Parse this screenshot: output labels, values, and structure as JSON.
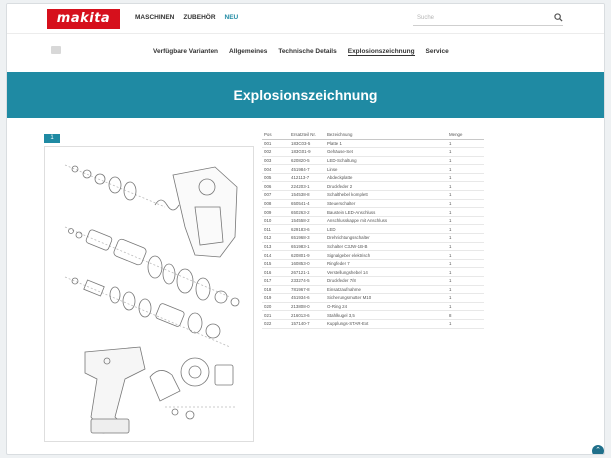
{
  "brand": {
    "logo_text": "makita",
    "color": "#d6101c",
    "accent": "#1f8aa3"
  },
  "nav": {
    "items": [
      {
        "label": "MASCHINEN",
        "active": false
      },
      {
        "label": "ZUBEHÖR",
        "active": false
      },
      {
        "label": "NEU",
        "active": true
      }
    ]
  },
  "search": {
    "placeholder": "Suche",
    "icon": "search-icon"
  },
  "subnav": {
    "items": [
      {
        "label": "Verfügbare Varianten",
        "active": false
      },
      {
        "label": "Allgemeines",
        "active": false
      },
      {
        "label": "Technische Details",
        "active": false
      },
      {
        "label": "Explosionszeichnung",
        "active": true
      },
      {
        "label": "Service",
        "active": false
      }
    ]
  },
  "banner": {
    "title": "Explosionszeichnung"
  },
  "diagram": {
    "page_label": "1"
  },
  "parts_table": {
    "headers": {
      "pos": "Pos",
      "nr": "Ersatzteil Nr.",
      "name": "Bezeichnung",
      "qty": "Menge"
    },
    "rows": [
      {
        "pos": "001",
        "nr": "183C03-5",
        "name": "Platte 1",
        "qty": "1"
      },
      {
        "pos": "002",
        "nr": "183G01-9",
        "name": "Gehäuse-Set",
        "qty": "1"
      },
      {
        "pos": "003",
        "nr": "620820-5",
        "name": "LED-Schaltung",
        "qty": "1"
      },
      {
        "pos": "004",
        "nr": "451984-7",
        "name": "Linse",
        "qty": "1"
      },
      {
        "pos": "005",
        "nr": "412113-7",
        "name": "Abdeckplatte",
        "qty": "1"
      },
      {
        "pos": "006",
        "nr": "224203-1",
        "name": "Druckfeder 2",
        "qty": "1"
      },
      {
        "pos": "007",
        "nr": "154538-8",
        "name": "Schalthebel komplett",
        "qty": "1"
      },
      {
        "pos": "008",
        "nr": "650541-4",
        "name": "Steuerschalter",
        "qty": "1"
      },
      {
        "pos": "009",
        "nr": "650263-2",
        "name": "Baustein LED-Anschluss",
        "qty": "1"
      },
      {
        "pos": "010",
        "nr": "154558-2",
        "name": "Anschlusskappe mit Anschluss",
        "qty": "1"
      },
      {
        "pos": "011",
        "nr": "629183-6",
        "name": "LED",
        "qty": "1"
      },
      {
        "pos": "012",
        "nr": "651968-3",
        "name": "Drehrichtungsschalter",
        "qty": "1"
      },
      {
        "pos": "013",
        "nr": "651983-1",
        "name": "Schalter C3JW-1B-B",
        "qty": "1"
      },
      {
        "pos": "014",
        "nr": "620801-9",
        "name": "Signalgeber elektrisch",
        "qty": "1"
      },
      {
        "pos": "015",
        "nr": "160853-0",
        "name": "Ringfeder 7",
        "qty": "1"
      },
      {
        "pos": "016",
        "nr": "267121-1",
        "name": "Verstellungshebel 14",
        "qty": "1"
      },
      {
        "pos": "017",
        "nr": "233274-5",
        "name": "Druckfeder 7/8",
        "qty": "1"
      },
      {
        "pos": "018",
        "nr": "781967-8",
        "name": "Einsatzaufnahme",
        "qty": "1"
      },
      {
        "pos": "019",
        "nr": "451934-6",
        "name": "Sicherungsmutter M10",
        "qty": "1"
      },
      {
        "pos": "020",
        "nr": "213808-0",
        "name": "O-Ring 24",
        "qty": "1"
      },
      {
        "pos": "021",
        "nr": "216013-6",
        "name": "Stahlkugel 3,5",
        "qty": "8"
      },
      {
        "pos": "022",
        "nr": "157140-7",
        "name": "Kupplungs-STAR-Ext",
        "qty": "1"
      }
    ]
  },
  "fab": {
    "icon": "chevron-up-icon",
    "glyph": "⌃"
  }
}
